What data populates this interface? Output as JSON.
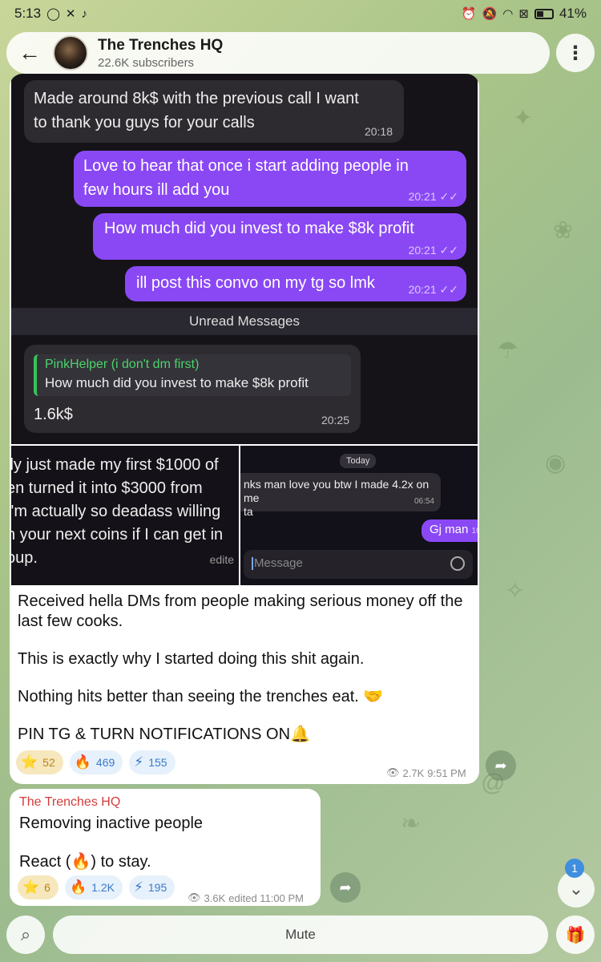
{
  "status_bar": {
    "time": "5:13",
    "battery": "41%"
  },
  "header": {
    "title": "The Trenches HQ",
    "subtitle": "22.6K subscribers"
  },
  "post1": {
    "screenshot1": {
      "msg_in": {
        "text_line1": "Made around 8k$ with the previous call I want",
        "text_line2": "to thank you guys for your calls",
        "time": "20:18"
      },
      "msg_out1": {
        "text_line1": "Love to hear that once i start adding people in",
        "text_line2": "few hours ill add you",
        "time": "20:21"
      },
      "msg_out2": {
        "text": "How much did you invest to make $8k profit",
        "time": "20:21"
      },
      "msg_out3": {
        "text": "ill post this convo on my tg so lmk",
        "time": "20:21"
      },
      "unread": "Unread Messages",
      "reply": {
        "name": "PinkHelper (i don't dm first)",
        "quote": "How much did you invest to make $8k profit",
        "text": "1.6k$",
        "time": "20:25"
      }
    },
    "screenshot2": {
      "lines": [
        "lly just made my first $1000 of",
        "en turned it into $3000 from",
        "I'm actually so deadass willing",
        "n your next coins if I can get in",
        "oup."
      ],
      "edited": "edite"
    },
    "screenshot3": {
      "day": "Today",
      "in_line1": "nks man love you btw I made 4.2x on me",
      "in_line2": "ta",
      "in_time": "06:54",
      "out_text": "Gj man",
      "out_time": "10",
      "input_placeholder": "Message"
    },
    "caption": [
      "Received hella DMs from people making serious money off the last few cooks.",
      "This is exactly why I started doing this shit again.",
      "Nothing hits better than seeing the trenches eat. 🤝",
      "PIN TG & TURN NOTIFICATIONS ON🔔"
    ],
    "reactions": [
      {
        "emoji": "⭐",
        "count": "52"
      },
      {
        "emoji": "🔥",
        "count": "469"
      },
      {
        "emoji": "⚡",
        "count": "155"
      }
    ],
    "views": "2.7K",
    "time": "9:51 PM"
  },
  "post2": {
    "author": "The Trenches HQ",
    "line1": "Removing inactive people",
    "line2": "React (🔥) to stay.",
    "reactions": [
      {
        "emoji": "⭐",
        "count": "6"
      },
      {
        "emoji": "🔥",
        "count": "1.2K"
      },
      {
        "emoji": "⚡",
        "count": "195"
      }
    ],
    "views": "3.6K",
    "edited_time": "edited 11:00 PM"
  },
  "unread_count": "1",
  "bottom": {
    "mute_label": "Mute"
  },
  "colors": {
    "accent": "#8a48f5",
    "author_red": "#d43b3b",
    "badge_blue": "#3f8ee0"
  }
}
